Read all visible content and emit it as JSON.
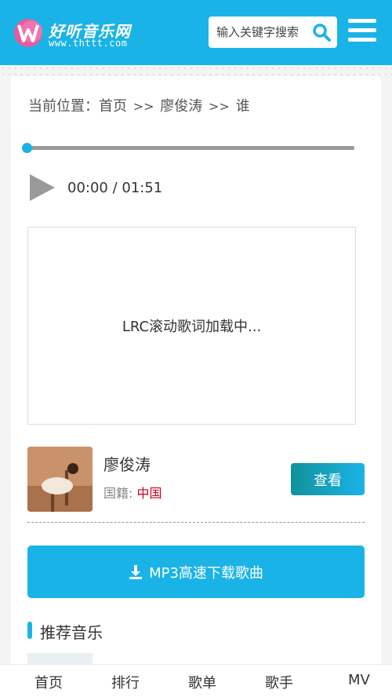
{
  "header": {
    "logo_title": "好听音乐网",
    "logo_url": "www.thttt.com",
    "search_placeholder": "输入关键字搜索",
    "search_icon": "search-icon",
    "menu_icon": "hamburger-menu-icon",
    "bg_color": "#1ab3e7"
  },
  "breadcrumb": {
    "label": "当前位置：",
    "home": "首页",
    "sep1": ">>",
    "artist": "廖俊涛",
    "sep2": ">>",
    "song": "谁"
  },
  "player": {
    "progress": 0,
    "time": "00:00 / 01:51",
    "play_icon": "play-icon"
  },
  "lyrics": {
    "loading_text": "LRC滚动歌词加载中..."
  },
  "artist": {
    "name": "廖俊涛",
    "nationality_label": "国籍:",
    "nationality_value": "中国",
    "view_button": "查看"
  },
  "download": {
    "label": "MP3高速下载歌曲",
    "icon": "download-icon"
  },
  "recommend": {
    "title": "推荐音乐"
  },
  "bottom_nav": {
    "items": [
      "首页",
      "排行",
      "歌单",
      "歌手",
      "MV"
    ]
  },
  "colors": {
    "accent": "#1ab3e7",
    "nationality": "#d0021b"
  }
}
